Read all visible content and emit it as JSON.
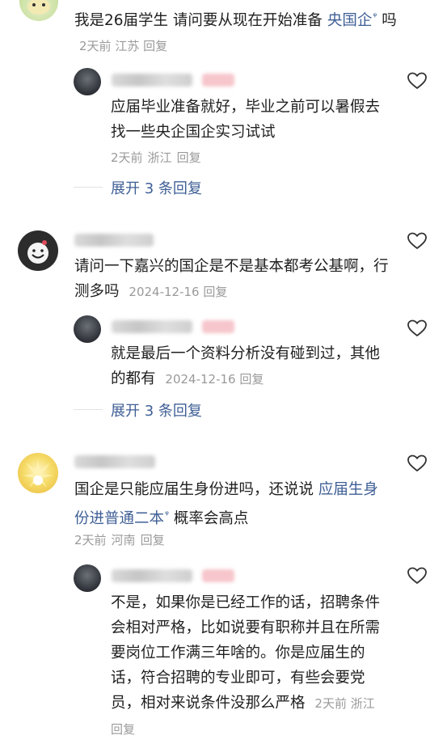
{
  "comments": [
    {
      "text_parts": [
        "我是26届学生 请问要从现在开始准备 ",
        "央国企",
        " 吗"
      ],
      "meta": {
        "time": "2天前",
        "location": "江苏",
        "reply": "回复"
      },
      "reply": {
        "text": "应届毕业准备就好，毕业之前可以暑假去找一些央企国企实习试试",
        "meta": {
          "time": "2天前",
          "location": "浙江",
          "reply": "回复"
        }
      },
      "expand": "展开 3 条回复"
    },
    {
      "text": "请问一下嘉兴的国企是不是基本都考公基啊，行测多吗",
      "meta": {
        "time": "2024-12-16",
        "reply": "回复"
      },
      "reply": {
        "text": "就是最后一个资料分析没有碰到过，其他的都有",
        "meta": {
          "time": "2024-12-16",
          "reply": "回复"
        }
      },
      "expand": "展开 3 条回复"
    },
    {
      "text_parts": [
        "国企是只能应届生身份进吗，还说说 ",
        "应届生身份进普通二本",
        " 概率会高点"
      ],
      "meta": {
        "time": "2天前",
        "location": "河南",
        "reply": "回复"
      },
      "reply": {
        "text": "不是，如果你是已经工作的话，招聘条件会相对严格，比如说要有职称并且在所需要岗位工作满三年啥的。你是应届生的话，符合招聘的专业即可，有些会要党员，相对来说条件没那么严格",
        "meta": {
          "time": "2天前",
          "location": "浙江",
          "reply": "回复"
        }
      }
    }
  ],
  "search_glyph": "ᵠ",
  "colors": {
    "link": "#3f5f96",
    "meta": "#9a9a9a",
    "text": "#1f1f1f"
  },
  "icons": {
    "like": "heart-outline-icon"
  }
}
